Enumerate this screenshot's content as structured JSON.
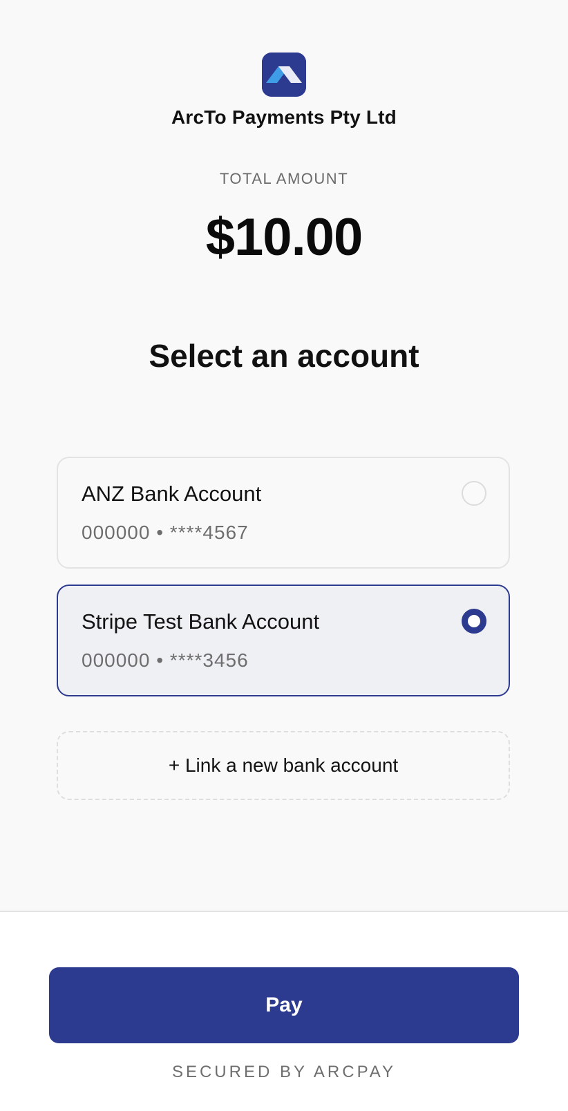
{
  "merchant": {
    "logo_icon": "arcto-logo-icon",
    "name": "ArcTo Payments Pty Ltd"
  },
  "total": {
    "label": "TOTAL AMOUNT",
    "amount": "$10.00"
  },
  "section_title": "Select an account",
  "accounts": [
    {
      "name": "ANZ Bank Account",
      "detail": "000000 • ****4567",
      "selected": false
    },
    {
      "name": "Stripe Test Bank Account",
      "detail": "000000 • ****3456",
      "selected": true
    }
  ],
  "link_new_label": "+ Link a new bank account",
  "footer": {
    "pay_label": "Pay",
    "secured_text": "SECURED BY ARCPAY"
  },
  "colors": {
    "brand": "#2c3a8f",
    "logo_light_blue": "#3f9ce6",
    "background": "#f9f9f9"
  }
}
